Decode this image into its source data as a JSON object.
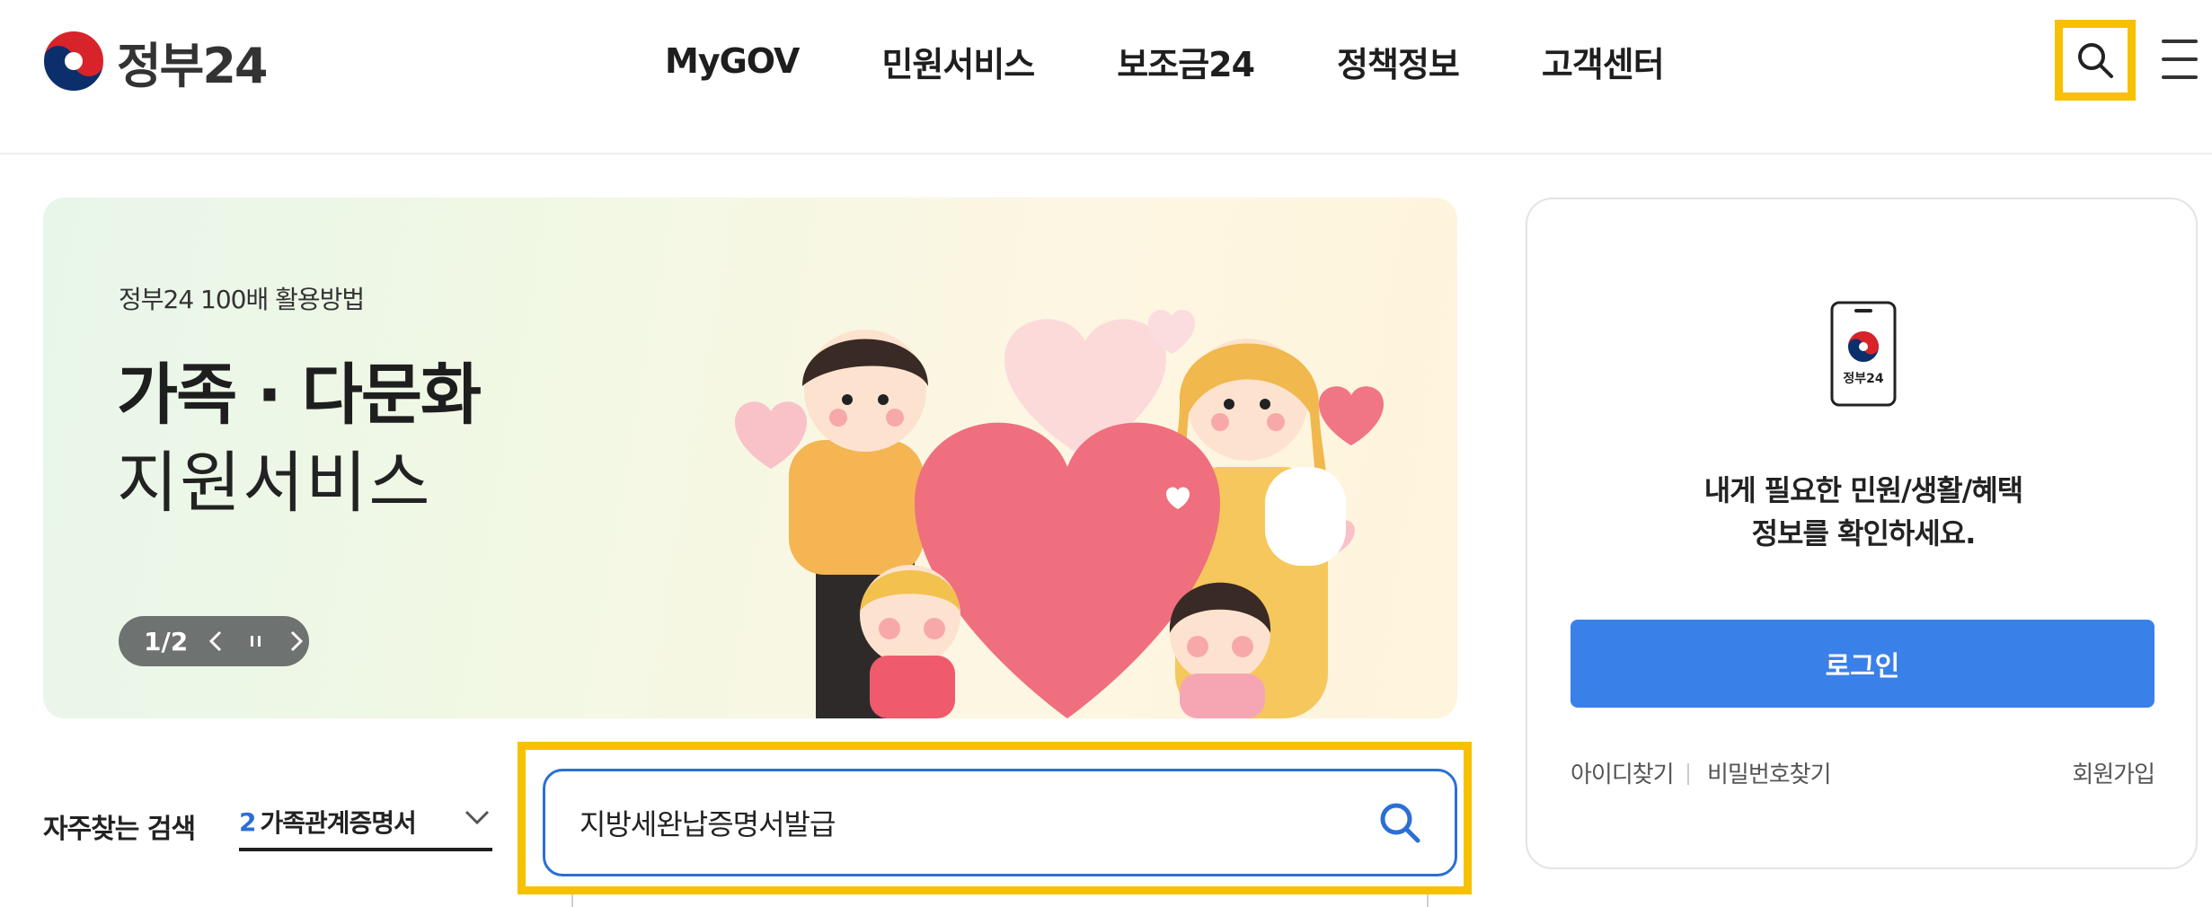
{
  "header": {
    "logo_text": "정부24",
    "nav": [
      "MyGOV",
      "민원서비스",
      "보조금24",
      "정책정보",
      "고객센터"
    ],
    "search_icon": "search-icon",
    "menu_icon": "hamburger-menu-icon",
    "highlight_color": "#f7c000"
  },
  "banner": {
    "subtitle": "정부24 100배 활용방법",
    "title": "가족 · 다문화",
    "title2": "지원서비스",
    "counter": "1/2"
  },
  "frequent_search": {
    "label": "자주찾는 검색",
    "rank": "2",
    "term": "가족관계증명서"
  },
  "search": {
    "value": "지방세완납증명서발급",
    "accent": "#2b6fd6"
  },
  "login": {
    "app_label": "정부24",
    "message_line1": "내게 필요한 민원/생활/혜택",
    "message_line2": "정보를 확인하세요.",
    "button": "로그인",
    "find_id": "아이디찾기",
    "find_password": "비밀번호찾기",
    "signup": "회원가입",
    "button_color": "#3a80e9"
  }
}
